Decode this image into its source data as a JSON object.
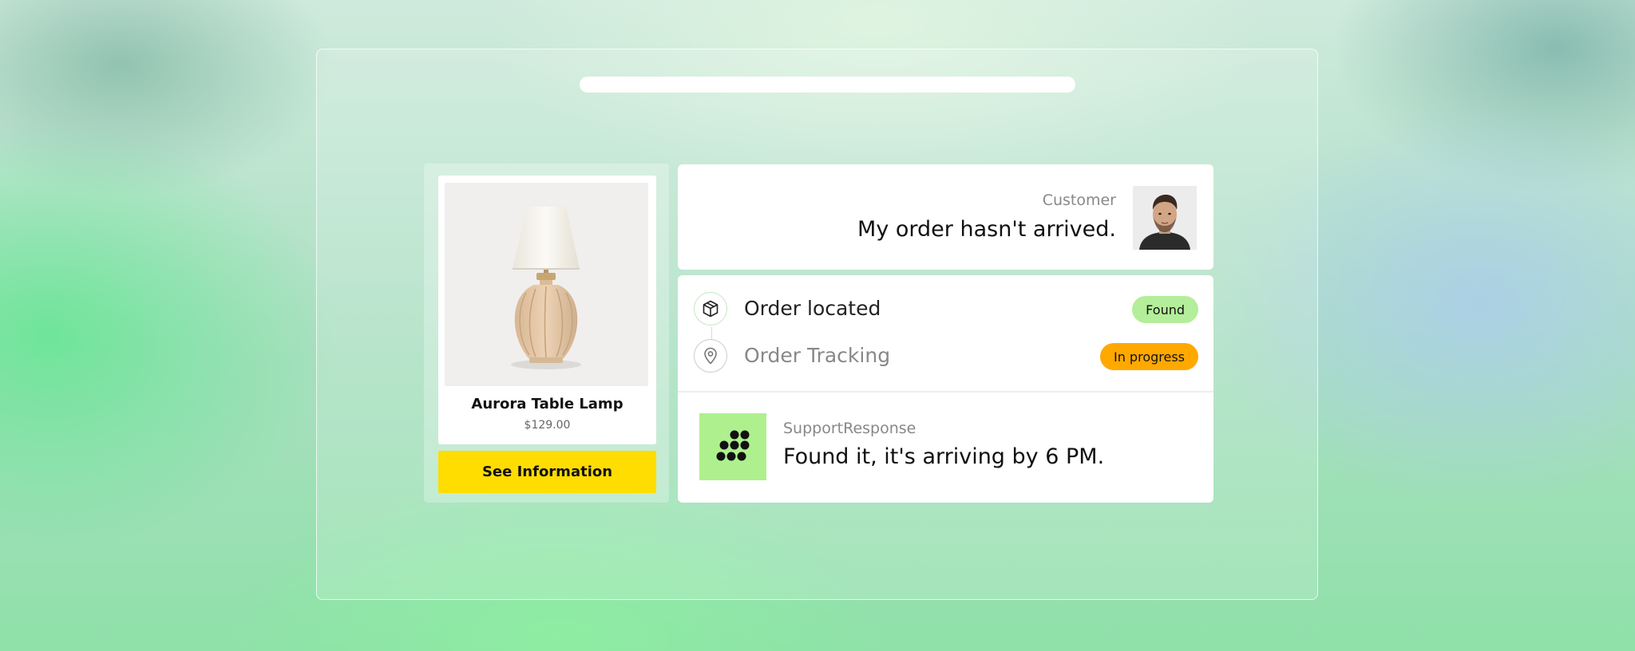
{
  "product": {
    "name": "Aurora Table Lamp",
    "price": "$129.00",
    "button_label": "See Information"
  },
  "customer": {
    "label": "Customer",
    "message": "My order hasn't arrived."
  },
  "steps": [
    {
      "label": "Order located",
      "badge": "Found",
      "icon": "package-icon",
      "badge_color": "#b4ee9a",
      "text_color": "#222222"
    },
    {
      "label": "Order Tracking",
      "badge": "In progress",
      "icon": "location-pin-icon",
      "badge_color": "#ffa800",
      "text_color": "#888888"
    }
  ],
  "support": {
    "label": "SupportResponse",
    "message": "Found it, it's arriving by 6 PM.",
    "brand_color": "#aef08e"
  },
  "colors": {
    "accent_button": "#ffdd00"
  }
}
